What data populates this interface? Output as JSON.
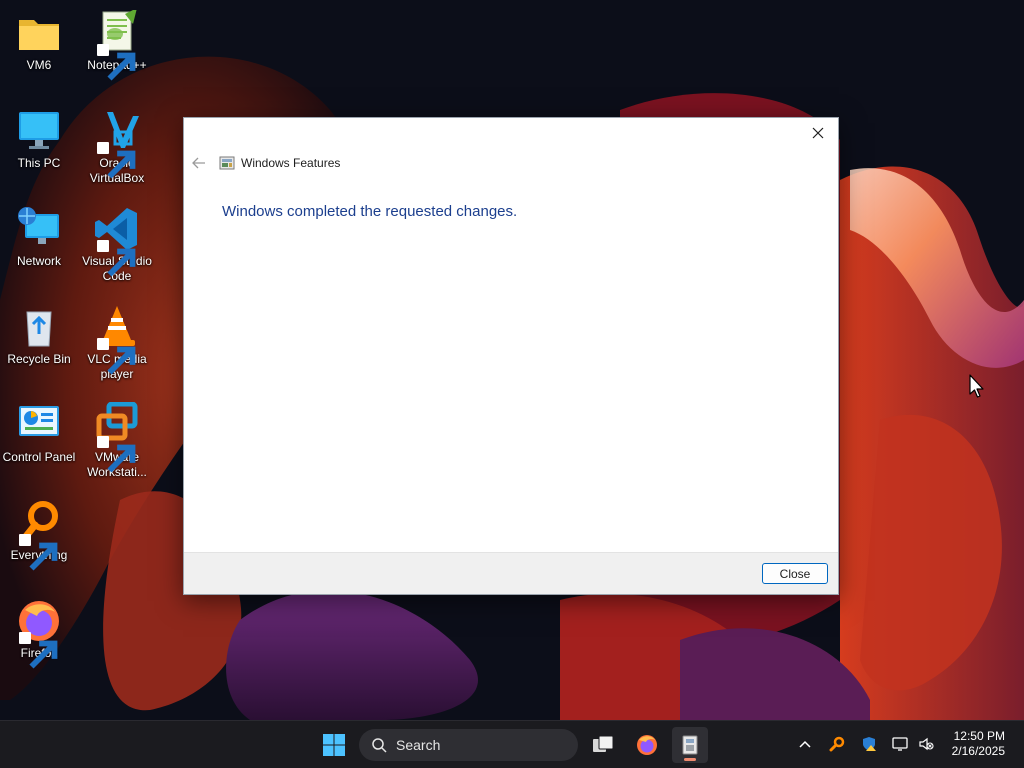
{
  "desktop": {
    "icons": [
      {
        "label": "VM6",
        "icon": "folder-icon"
      },
      {
        "label": "Notepad++",
        "icon": "notepad-plus-plus-icon"
      },
      {
        "label": "This PC",
        "icon": "monitor-icon"
      },
      {
        "label": "Oracle VirtualBox",
        "icon": "virtualbox-icon"
      },
      {
        "label": "Network",
        "icon": "network-icon"
      },
      {
        "label": "Visual Studio Code",
        "icon": "vscode-icon"
      },
      {
        "label": "Recycle Bin",
        "icon": "recycle-bin-icon"
      },
      {
        "label": "VLC media player",
        "icon": "vlc-icon"
      },
      {
        "label": "Control Panel",
        "icon": "control-panel-icon"
      },
      {
        "label": "VMware Workstati...",
        "icon": "vmware-icon"
      },
      {
        "label": "Everything",
        "icon": "everything-search-icon"
      },
      {
        "label": "Firefox",
        "icon": "firefox-icon"
      }
    ]
  },
  "dialog": {
    "title": "Windows Features",
    "message": "Windows completed the requested changes.",
    "close_button_label": "Close"
  },
  "taskbar": {
    "search_label": "Search",
    "clock_time": "12:50 PM",
    "clock_date": "2/16/2025"
  },
  "colors": {
    "dialog_message": "#1c3f8e",
    "button_border": "#0067c0",
    "taskbar_bg": "#1b1b1f"
  }
}
